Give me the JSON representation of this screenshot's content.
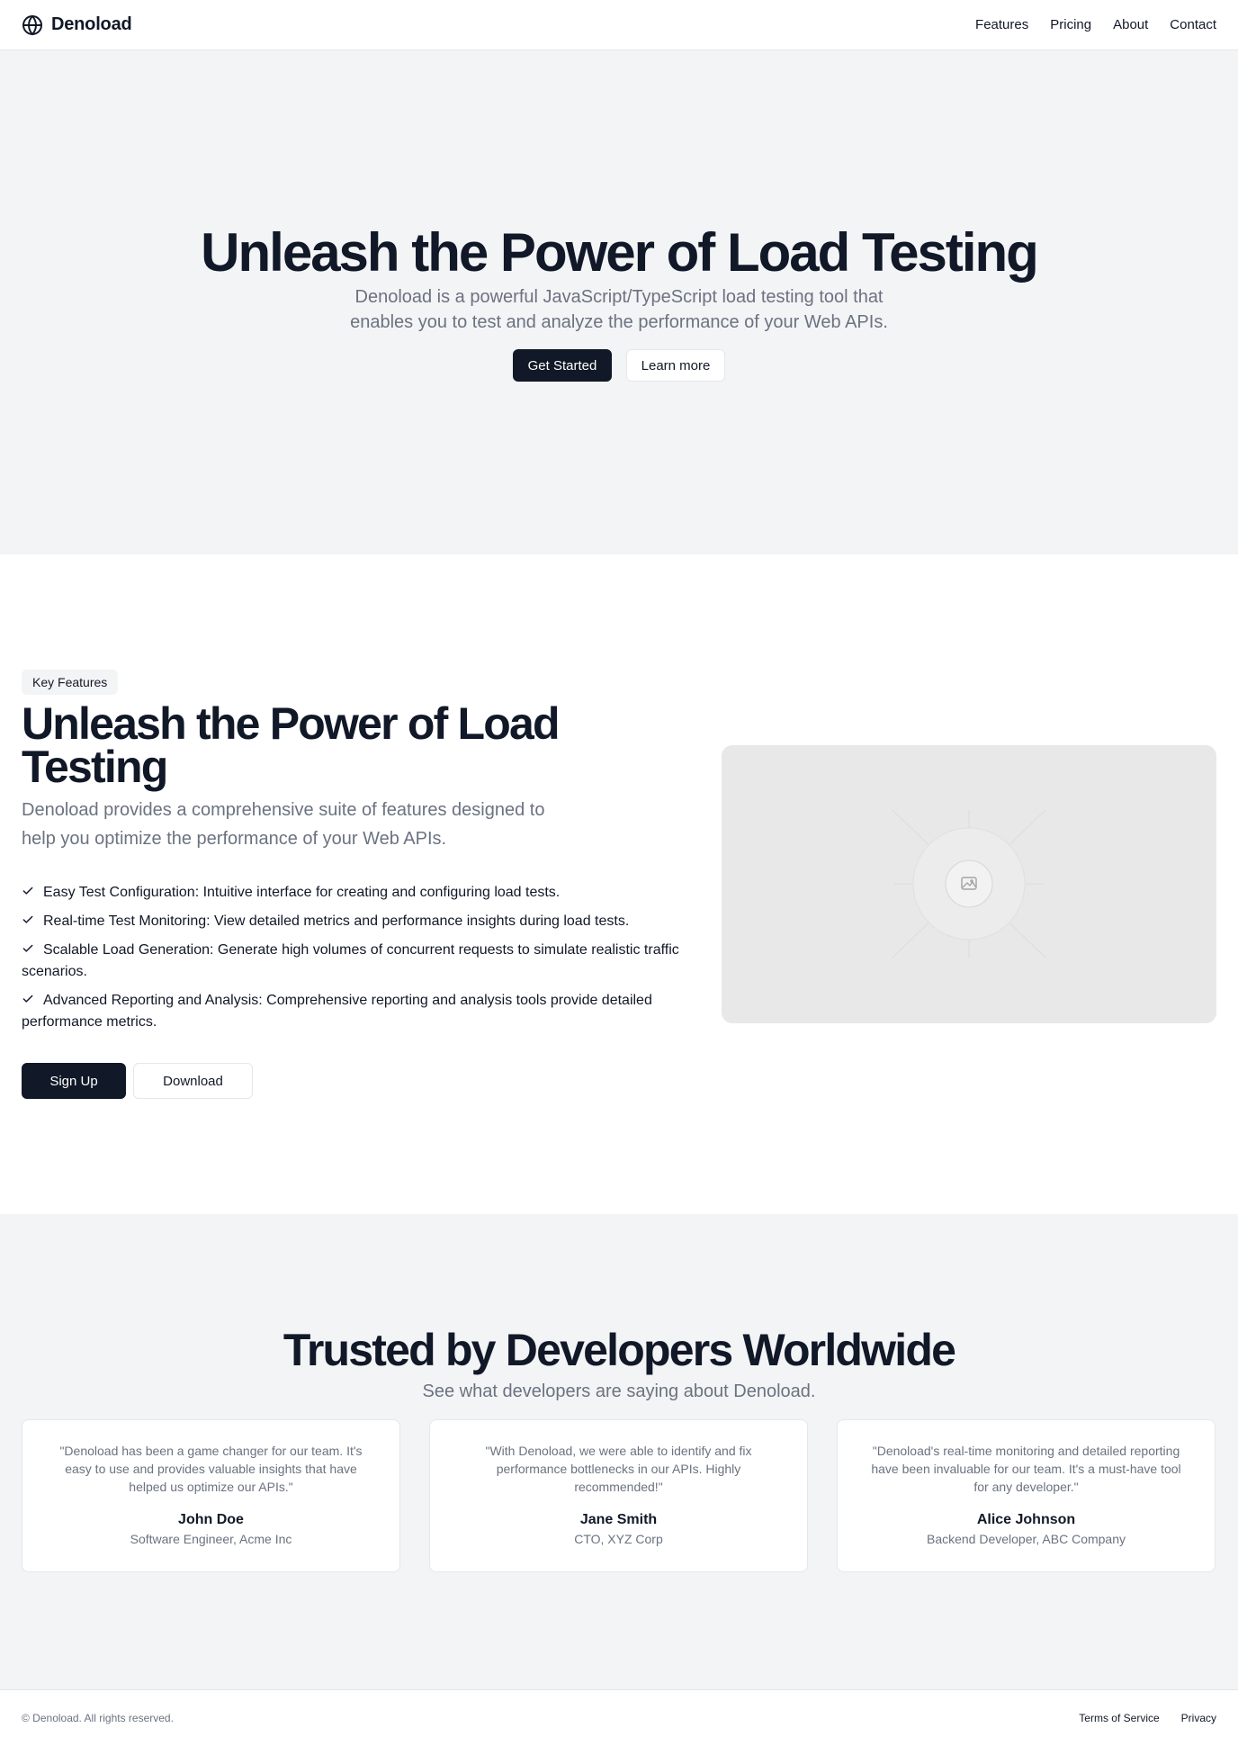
{
  "header": {
    "brand": "Denoload",
    "nav": [
      "Features",
      "Pricing",
      "About",
      "Contact"
    ]
  },
  "hero": {
    "title": "Unleash the Power of Load Testing",
    "subtitle": "Denoload is a powerful JavaScript/TypeScript load testing tool that enables you to test and analyze the performance of your Web APIs.",
    "primary_button": "Get Started",
    "secondary_button": "Learn more"
  },
  "features": {
    "badge": "Key Features",
    "title": "Unleash the Power of Load Testing",
    "subtitle": "Denoload provides a comprehensive suite of features designed to help you optimize the performance of your Web APIs.",
    "items": [
      "Easy Test Configuration: Intuitive interface for creating and configuring load tests.",
      "Real-time Test Monitoring: View detailed metrics and performance insights during load tests.",
      "Scalable Load Generation: Generate high volumes of concurrent requests to simulate realistic traffic scenarios.",
      "Advanced Reporting and Analysis: Comprehensive reporting and analysis tools provide detailed performance metrics."
    ],
    "primary_button": "Sign Up",
    "secondary_button": "Download",
    "image_icon": "image-placeholder-icon"
  },
  "testimonials": {
    "title": "Trusted by Developers Worldwide",
    "subtitle": "See what developers are saying about Denoload.",
    "items": [
      {
        "quote": "\"Denoload has been a game changer for our team. It's easy to use and provides valuable insights that have helped us optimize our APIs.\"",
        "name": "John Doe",
        "role": "Software Engineer, Acme Inc"
      },
      {
        "quote": "\"With Denoload, we were able to identify and fix performance bottlenecks in our APIs. Highly recommended!\"",
        "name": "Jane Smith",
        "role": "CTO, XYZ Corp"
      },
      {
        "quote": "\"Denoload's real-time monitoring and detailed reporting have been invaluable for our team. It's a must-have tool for any developer.\"",
        "name": "Alice Johnson",
        "role": "Backend Developer, ABC Company"
      }
    ]
  },
  "footer": {
    "copyright": "© Denoload. All rights reserved.",
    "links": [
      "Terms of Service",
      "Privacy"
    ]
  },
  "colors": {
    "primary": "#111827",
    "muted_text": "#6b7280",
    "section_bg": "#f3f4f6",
    "border": "#e5e7eb"
  }
}
